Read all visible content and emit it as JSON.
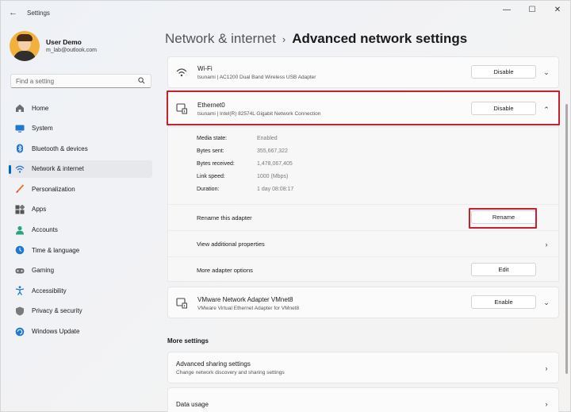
{
  "app": {
    "title": "Settings",
    "back_glyph": "←",
    "controls": {
      "minimize": "—",
      "maximize": "☐",
      "close": "✕"
    }
  },
  "user": {
    "name": "User Demo",
    "email": "m_lab@outlook.com"
  },
  "search": {
    "placeholder": "Find a setting",
    "icon": "search-icon"
  },
  "sidebar": {
    "items": [
      {
        "label": "Home",
        "icon": "home-icon"
      },
      {
        "label": "System",
        "icon": "monitor-icon"
      },
      {
        "label": "Bluetooth & devices",
        "icon": "bluetooth-icon"
      },
      {
        "label": "Network & internet",
        "icon": "wifi-icon",
        "active": true
      },
      {
        "label": "Personalization",
        "icon": "brush-icon"
      },
      {
        "label": "Apps",
        "icon": "apps-icon"
      },
      {
        "label": "Accounts",
        "icon": "person-icon"
      },
      {
        "label": "Time & language",
        "icon": "globe-clock-icon"
      },
      {
        "label": "Gaming",
        "icon": "gamepad-icon"
      },
      {
        "label": "Accessibility",
        "icon": "accessibility-icon"
      },
      {
        "label": "Privacy & security",
        "icon": "shield-icon"
      },
      {
        "label": "Windows Update",
        "icon": "update-icon"
      }
    ]
  },
  "breadcrumb": {
    "parent": "Network & internet",
    "separator": "›",
    "current": "Advanced network settings"
  },
  "adapters": {
    "wifi": {
      "title": "Wi-Fi",
      "subtitle": "tsunami | AC1200  Dual Band Wireless USB Adapter",
      "button": "Disable",
      "chevron": "⌄"
    },
    "ethernet": {
      "title": "Ethernet0",
      "subtitle": "tsunami | Intel(R) 82574L Gigabit Network Connection",
      "button": "Disable",
      "chevron": "⌃",
      "properties": [
        {
          "label": "Media state:",
          "value": "Enabled"
        },
        {
          "label": "Bytes sent:",
          "value": "355,667,322"
        },
        {
          "label": "Bytes received:",
          "value": "1,478,067,405"
        },
        {
          "label": "Link speed:",
          "value": "1000 (Mbps)"
        },
        {
          "label": "Duration:",
          "value": "1 day 08:08:17"
        }
      ],
      "rename_label": "Rename this adapter",
      "rename_button": "Rename",
      "view_props_label": "View additional properties",
      "more_options_label": "More adapter options",
      "edit_button": "Edit",
      "row_chevron": "›"
    },
    "vmware": {
      "title": "VMware Network Adapter VMnet8",
      "subtitle": "VMware Virtual Ethernet Adapter for VMnet8",
      "button": "Enable",
      "chevron": "⌄"
    }
  },
  "more_settings": {
    "title": "More settings",
    "items": [
      {
        "title": "Advanced sharing settings",
        "subtitle": "Change network discovery and sharing settings",
        "chevron": "›"
      },
      {
        "title": "Data usage",
        "chevron": "›"
      }
    ]
  },
  "colors": {
    "accent": "#0067c0",
    "highlight": "#c8202f"
  }
}
